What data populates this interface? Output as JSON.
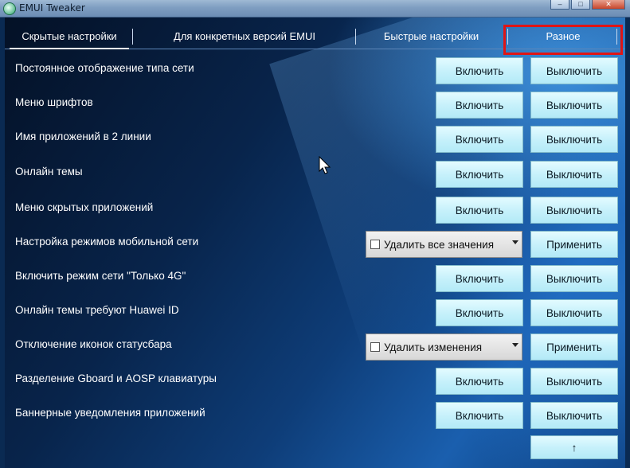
{
  "window": {
    "title": "EMUI Tweaker",
    "controls": [
      "–",
      "□",
      "✕"
    ]
  },
  "tabs": [
    {
      "label": "Скрытые настройки",
      "active": true
    },
    {
      "label": "Для конкретных версий EMUI",
      "active": false
    },
    {
      "label": "Быстрые настройки",
      "active": false
    },
    {
      "label": "Разное",
      "active": false,
      "highlighted": true
    }
  ],
  "rows": [
    {
      "label": "Постоянное отображение типа сети",
      "enable": "Включить",
      "disable": "Выключить"
    },
    {
      "label": "Меню шрифтов",
      "enable": "Включить",
      "disable": "Выключить"
    },
    {
      "label": "Имя приложений в 2 линии",
      "enable": "Включить",
      "disable": "Выключить"
    },
    {
      "label": "Онлайн темы",
      "enable": "Включить",
      "disable": "Выключить"
    },
    {
      "label": "Меню скрытых приложений",
      "enable": "Включить",
      "disable": "Выключить"
    },
    {
      "label": "Настройка режимов мобильной сети",
      "dropdown": "Удалить все значения",
      "apply": "Применить"
    },
    {
      "label": "Включить режим сети \"Только 4G\"",
      "enable": "Включить",
      "disable": "Выключить"
    },
    {
      "label": "Онлайн темы требуют Huawei ID",
      "enable": "Включить",
      "disable": "Выключить"
    },
    {
      "label": "Отключение иконок статусбара",
      "dropdown": "Удалить изменения",
      "apply": "Применить"
    },
    {
      "label": "Разделение Gboard и AOSP клавиатуры",
      "enable": "Включить",
      "disable": "Выключить"
    },
    {
      "label": "Баннерные уведомления приложений",
      "enable": "Включить",
      "disable": "Выключить"
    }
  ],
  "scroll_top_button": "↑",
  "colors": {
    "highlight": "#e01515",
    "button_fill": "#c7f1fb"
  }
}
